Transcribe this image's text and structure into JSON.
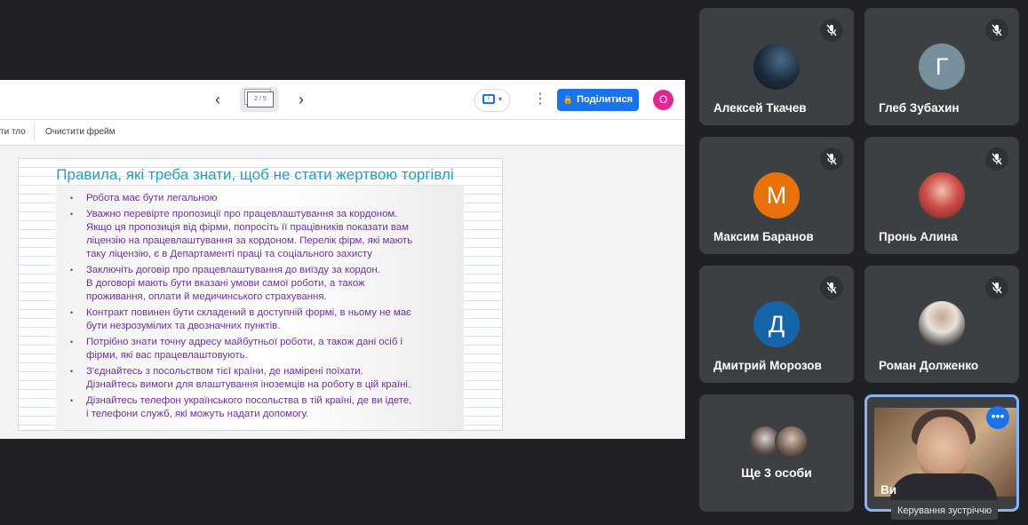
{
  "jamboard": {
    "frame_indicator": "2 / 5",
    "share_label": "Поділитися",
    "account_initial": "О",
    "set_background_label": "ти тло",
    "clear_frame_label": "Очистити фрейм"
  },
  "slide": {
    "title": "Правила, які треба знати, щоб не стати жертвою торгівлі",
    "rules": [
      [
        "Робота має бути легальною"
      ],
      [
        "Уважно перевірте пропозиції про працевлаштування  за кордоном.",
        "Якщо ця пропозиція від фірми, попросіть її працівників показати вам",
        "ліцензію на працевлаштування  за кордоном.  Перелік фірм, які мають",
        "таку ліцензію, є в Департаменті  праці та соціального захисту"
      ],
      [
        "Заключіть договір  про працевлаштування  до виїзду за кордон.",
        "В договорі мають бути  вказані умови самої роботи, а також",
        "проживання, оплати й медичинського  страхування."
      ],
      [
        "Контракт повинен бути складений в доступній формі, в ньому не має",
        "бути незрозумілих  та двозначних  пунктів."
      ],
      [
        "Потрібно знати точну адресу майбутньої роботи, а також дані осіб  і",
        "фірми, які вас працевлаштовують."
      ],
      [
        "З'єднайтесь з посольством  тієї країни, де намірені  поїхати.",
        "Дізнайтесь вимоги для влаштування  іноземців на роботу в цій країні."
      ],
      [
        "Дізнайтесь телефон українського посольства в тій країні, де ви ідете,",
        "і телефони  служб,  які можуть надати допомогу."
      ]
    ]
  },
  "participants": [
    {
      "name": "Алексей Ткачев",
      "initial": "",
      "color": "#1b2a3a"
    },
    {
      "name": "Глеб Зубахин",
      "initial": "Г",
      "color": "#78909c"
    },
    {
      "name": "Максим Баранов",
      "initial": "М",
      "color": "#e8710a"
    },
    {
      "name": "Пронь Алина",
      "initial": "",
      "color": "#b33a3a"
    },
    {
      "name": "Дмитрий Морозов",
      "initial": "Д",
      "color": "#1565a8"
    },
    {
      "name": "Роман Долженко",
      "initial": "",
      "color": "#d8d2cf"
    }
  ],
  "others": {
    "label": "Ще 3 особи"
  },
  "self": {
    "name": "Ви"
  },
  "tooltip": "Керування зустріччю",
  "icons": {
    "mic": "mic-off-icon",
    "more": "more-horiz-icon"
  }
}
